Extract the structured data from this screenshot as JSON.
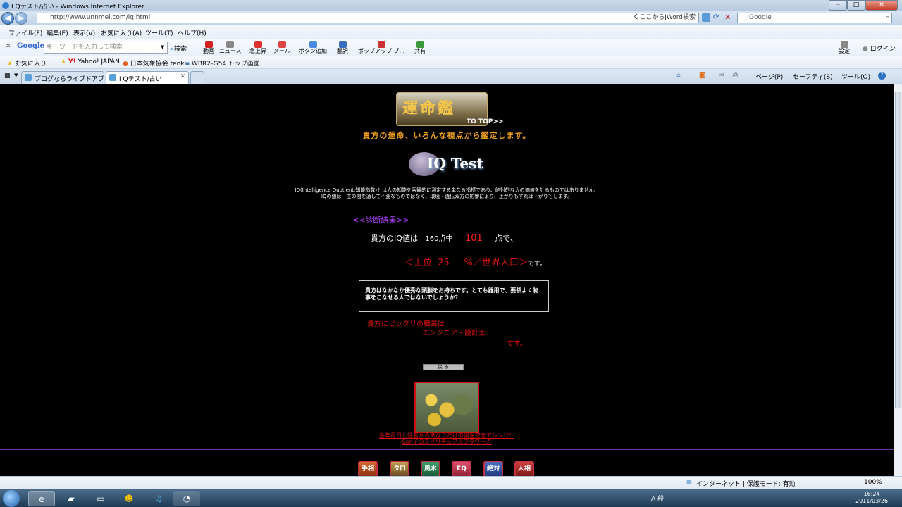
{
  "window": {
    "title": "I Qテスト/占い - Windows Internet Explorer",
    "min": "─",
    "max": "□",
    "close": "✕"
  },
  "address": {
    "url": "http://www.unnmei.com/iq.html",
    "suggest": "くここからJWord検索",
    "search_placeholder": "Google"
  },
  "menu": [
    "ファイル(F)",
    "編集(E)",
    "表示(V)",
    "お気に入り(A)",
    "ツール(T)",
    "ヘルプ(H)"
  ],
  "google_toolbar": {
    "brand": "Google",
    "placeholder": "キーワードを入力して検索",
    "search_label": "検索",
    "buttons": [
      "動画",
      "ニュース",
      "急上昇",
      "メール",
      "ボタン追加",
      "翻訳",
      "ポップアップ ブ...",
      "共有"
    ],
    "settings": "設定",
    "login": "ログイン"
  },
  "favorites": {
    "label": "お気に入り",
    "items": [
      "Yahoo! JAPAN",
      "日本気象協会 tenki",
      "WBR2-G54 トップ画面"
    ]
  },
  "tabs": [
    {
      "label": "ブログならライブドアブ..."
    },
    {
      "label": "I Qテスト/占い"
    }
  ],
  "command_bar": [
    "ページ(P)",
    "セーフティ(S)",
    "ツール(O)",
    "?"
  ],
  "page": {
    "logo_text": "運命鑑",
    "to_top": "TO TOP>>",
    "tagline": "貴方の運命、いろんな視点から鑑定します。",
    "iq_title": "IQ Test",
    "desc_line1": "IQ(Intelligence Quotient:知能指数)とは人の知能を客観的に測定する単なる指標であり、絶対的な人の価値を計るものではありません。",
    "desc_line2": "IQの値は一生の間を通して不変なものではなく、環境・遺伝双方の影響により、上がりもすれば下がりもします。",
    "result_heading": "<<診断結果>>",
    "iq_prefix": "貴方のIQ値は",
    "iq_of": "160点中",
    "iq_value": "101",
    "iq_suffix": "点で、",
    "rank_prefix": "＜上位",
    "rank_value": "25",
    "rank_suffix": "%／世界人口＞",
    "rank_end": "です。",
    "comment": "貴方はなかなか優秀な頭脳をお持ちです。とても器用で、要領よく物事をこなせる人ではないでしょうか？",
    "job_label": "貴方にピッタリの職業は",
    "job": "エンジニア・設計士",
    "job_end": "です。",
    "back_button": "戻 る",
    "flower_link_1": "生年月日と姓名からあなただけの誕生花をアレンジ！",
    "flower_link_2": "Sen子のスピリチュアルフラワー占",
    "footer_icons": [
      "手相",
      "タロット",
      "風水",
      "EQ",
      "絶対音感",
      "人相占い"
    ]
  },
  "status": {
    "zone": "インターネット | 保護モード: 有効",
    "zoom": "100%"
  },
  "taskbar": {
    "time": "16:24",
    "date": "2011/03/26",
    "ime": "A 般"
  }
}
